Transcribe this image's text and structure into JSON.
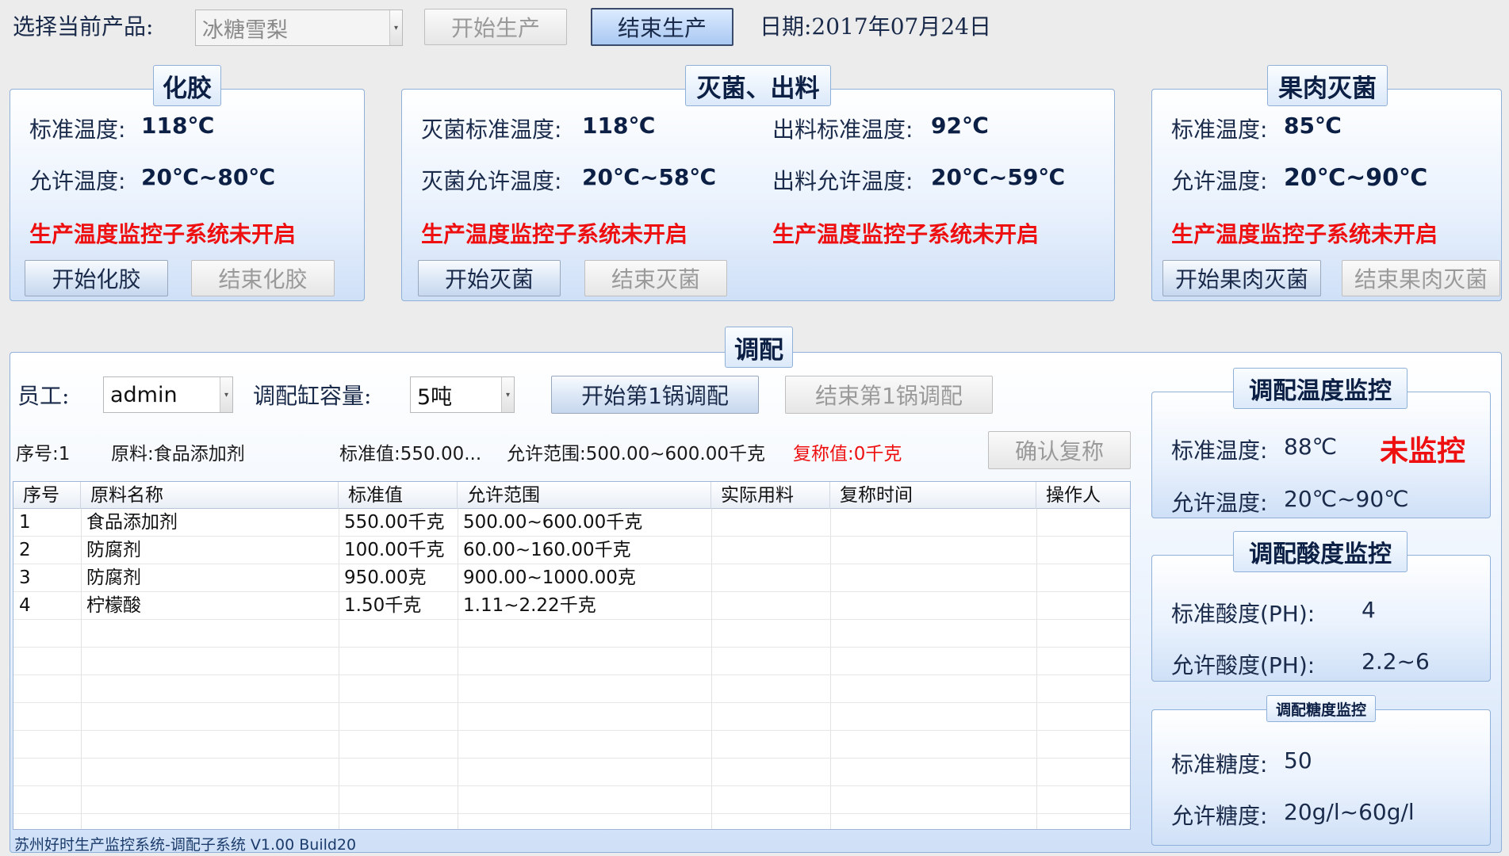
{
  "top": {
    "product_label": "选择当前产品:",
    "product_value": "冰糖雪梨",
    "start_production": "开始生产",
    "end_production": "结束生产",
    "date": "日期:2017年07月24日"
  },
  "hua_jiao": {
    "title": "化胶",
    "std_label": "标准温度:",
    "std_value": "118℃",
    "allow_label": "允许温度:",
    "allow_value": "20℃~80℃",
    "warning": "生产温度监控子系统未开启",
    "start": "开始化胶",
    "end": "结束化胶"
  },
  "mie_jun": {
    "title": "灭菌、出料",
    "std_label": "灭菌标准温度:",
    "std_value": "118℃",
    "allow_label": "灭菌允许温度:",
    "allow_value": "20℃~58℃",
    "out_std_label": "出料标准温度:",
    "out_std_value": "92℃",
    "out_allow_label": "出料允许温度:",
    "out_allow_value": "20℃~59℃",
    "warning1": "生产温度监控子系统未开启",
    "warning2": "生产温度监控子系统未开启",
    "start": "开始灭菌",
    "end": "结束灭菌"
  },
  "guo_rou": {
    "title": "果肉灭菌",
    "std_label": "标准温度:",
    "std_value": "85℃",
    "allow_label": "允许温度:",
    "allow_value": "20℃~90℃",
    "warning": "生产温度监控子系统未开启",
    "start": "开始果肉灭菌",
    "end": "结束果肉灭菌"
  },
  "tiao_pei": {
    "title": "调配",
    "staff_label": "员工:",
    "staff_value": "admin",
    "capacity_label": "调配缸容量:",
    "capacity_value": "5吨",
    "start_batch": "开始第1锅调配",
    "end_batch": "结束第1锅调配",
    "info_seq": "序号:1",
    "info_material": "原料:食品添加剂",
    "info_std": "标准值:550.00...",
    "info_range": "允许范围:500.00~600.00千克",
    "info_recheck": "复称值:0千克",
    "confirm_recheck": "确认复称",
    "columns": [
      "序号",
      "原料名称",
      "标准值",
      "允许范围",
      "实际用料",
      "复称时间",
      "操作人"
    ],
    "rows": [
      [
        "1",
        "食品添加剂",
        "550.00千克",
        "500.00~600.00千克",
        "",
        "",
        ""
      ],
      [
        "2",
        "防腐剂",
        "100.00千克",
        "60.00~160.00千克",
        "",
        "",
        ""
      ],
      [
        "3",
        "防腐剂",
        "950.00克",
        "900.00~1000.00克",
        "",
        "",
        ""
      ],
      [
        "4",
        "柠檬酸",
        "1.50千克",
        "1.11~2.22千克",
        "",
        "",
        ""
      ]
    ],
    "status_bar": "苏州好时生产监控系统-调配子系统 V1.00  Build20"
  },
  "temp_monitor": {
    "title": "调配温度监控",
    "std_label": "标准温度:",
    "std_value": "88℃",
    "status": "未监控",
    "allow_label": "允许温度:",
    "allow_value": "20℃~90℃"
  },
  "acid_monitor": {
    "title": "调配酸度监控",
    "std_label": "标准酸度(PH):",
    "std_value": "4",
    "allow_label": "允许酸度(PH):",
    "allow_value": "2.2~6"
  },
  "sugar_monitor": {
    "title": "调配糖度监控",
    "std_label": "标准糖度:",
    "std_value": "50",
    "allow_label": "允许糖度:",
    "allow_value": "20g/l~60g/l"
  },
  "colors": {
    "warning": "#ee1010",
    "group_border": "#8fb0d8",
    "title_text": "#0c1f44"
  }
}
